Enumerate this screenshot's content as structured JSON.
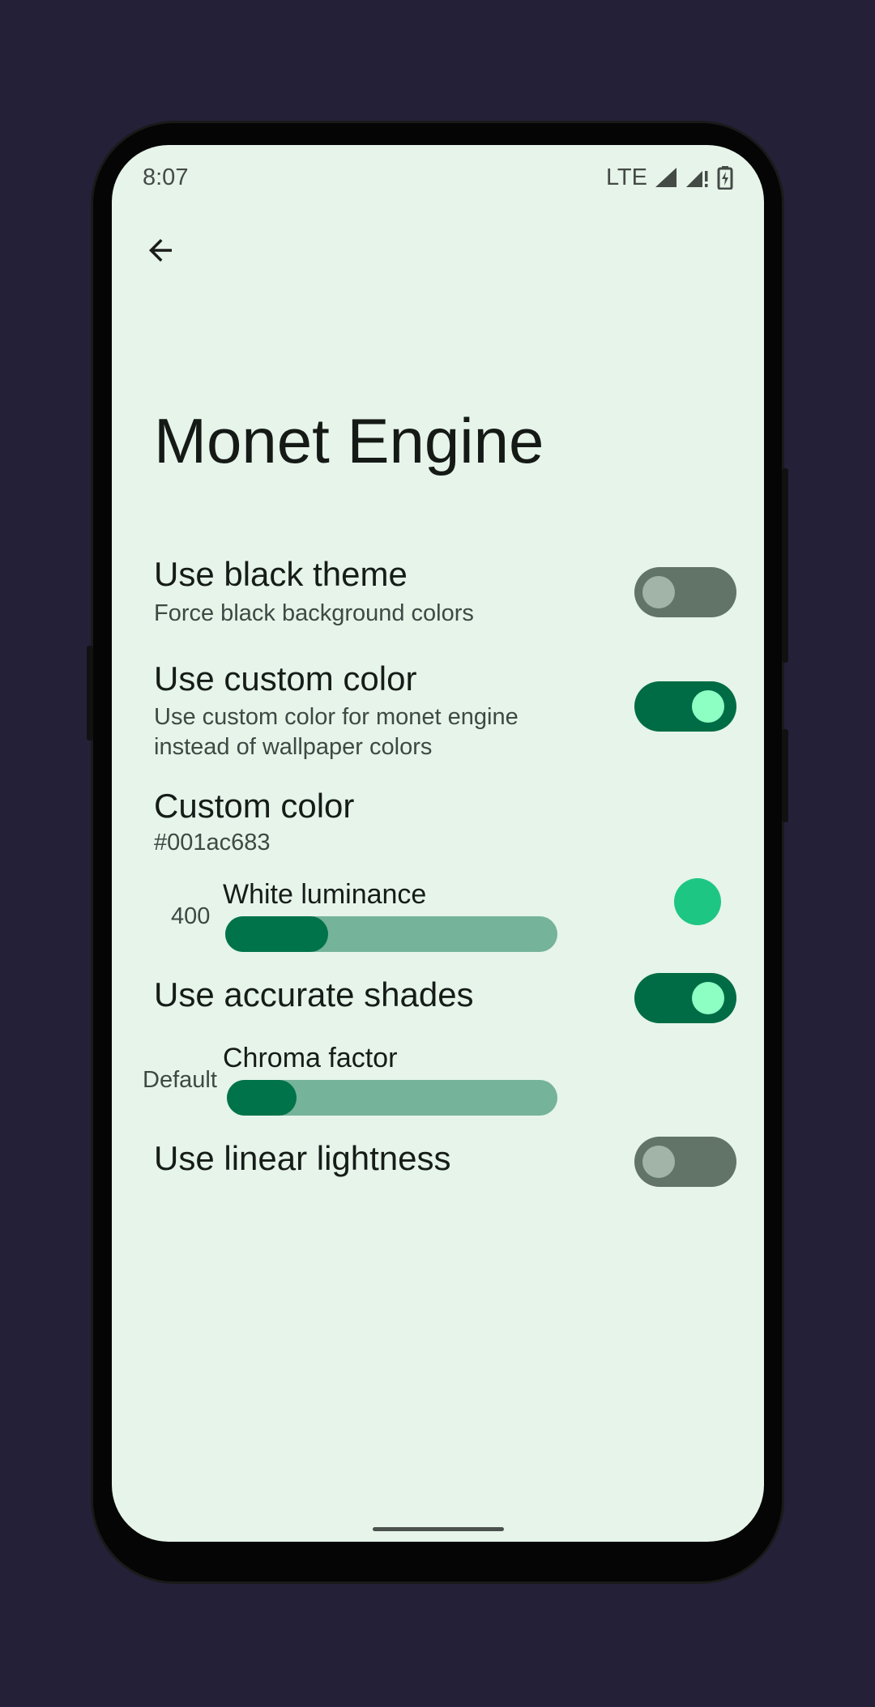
{
  "status_bar": {
    "time": "8:07",
    "network": "LTE"
  },
  "header": {
    "back_icon": "arrow-back-icon"
  },
  "page": {
    "title": "Monet Engine"
  },
  "settings": {
    "black_theme": {
      "title": "Use black theme",
      "subtitle": "Force black background colors",
      "enabled": false
    },
    "custom_color_toggle": {
      "title": "Use custom color",
      "subtitle": "Use custom color for monet engine instead of wallpaper colors",
      "enabled": true
    },
    "custom_color": {
      "title": "Custom color",
      "value": "#001ac683",
      "swatch": "#1ec683"
    },
    "white_luminance": {
      "label": "White luminance",
      "value": "400",
      "fraction": 0.31
    },
    "accurate_shades": {
      "title": "Use accurate shades",
      "enabled": true
    },
    "chroma_factor": {
      "label": "Chroma factor",
      "value": "Default",
      "fraction": 0.21
    },
    "linear_lightness": {
      "title": "Use linear lightness",
      "enabled": false
    }
  },
  "colors": {
    "accent": "#006c45",
    "background": "#e6f4ea",
    "track": "#75b39a"
  }
}
